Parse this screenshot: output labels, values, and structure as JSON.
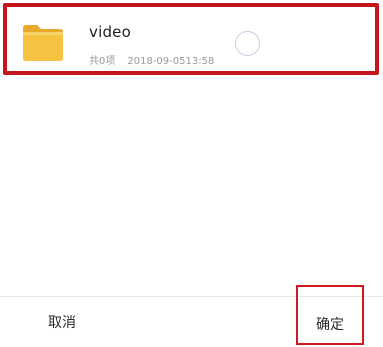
{
  "folder": {
    "name": "video",
    "item_count": "共0项",
    "modified": "2018-09-0513:58",
    "icon": "folder-icon"
  },
  "footer": {
    "cancel_label": "取消",
    "confirm_label": "确定"
  },
  "colors": {
    "highlight": "#c4141c",
    "folder_yellow": "#f5c242",
    "radio_outline": "#c9cfe3"
  }
}
